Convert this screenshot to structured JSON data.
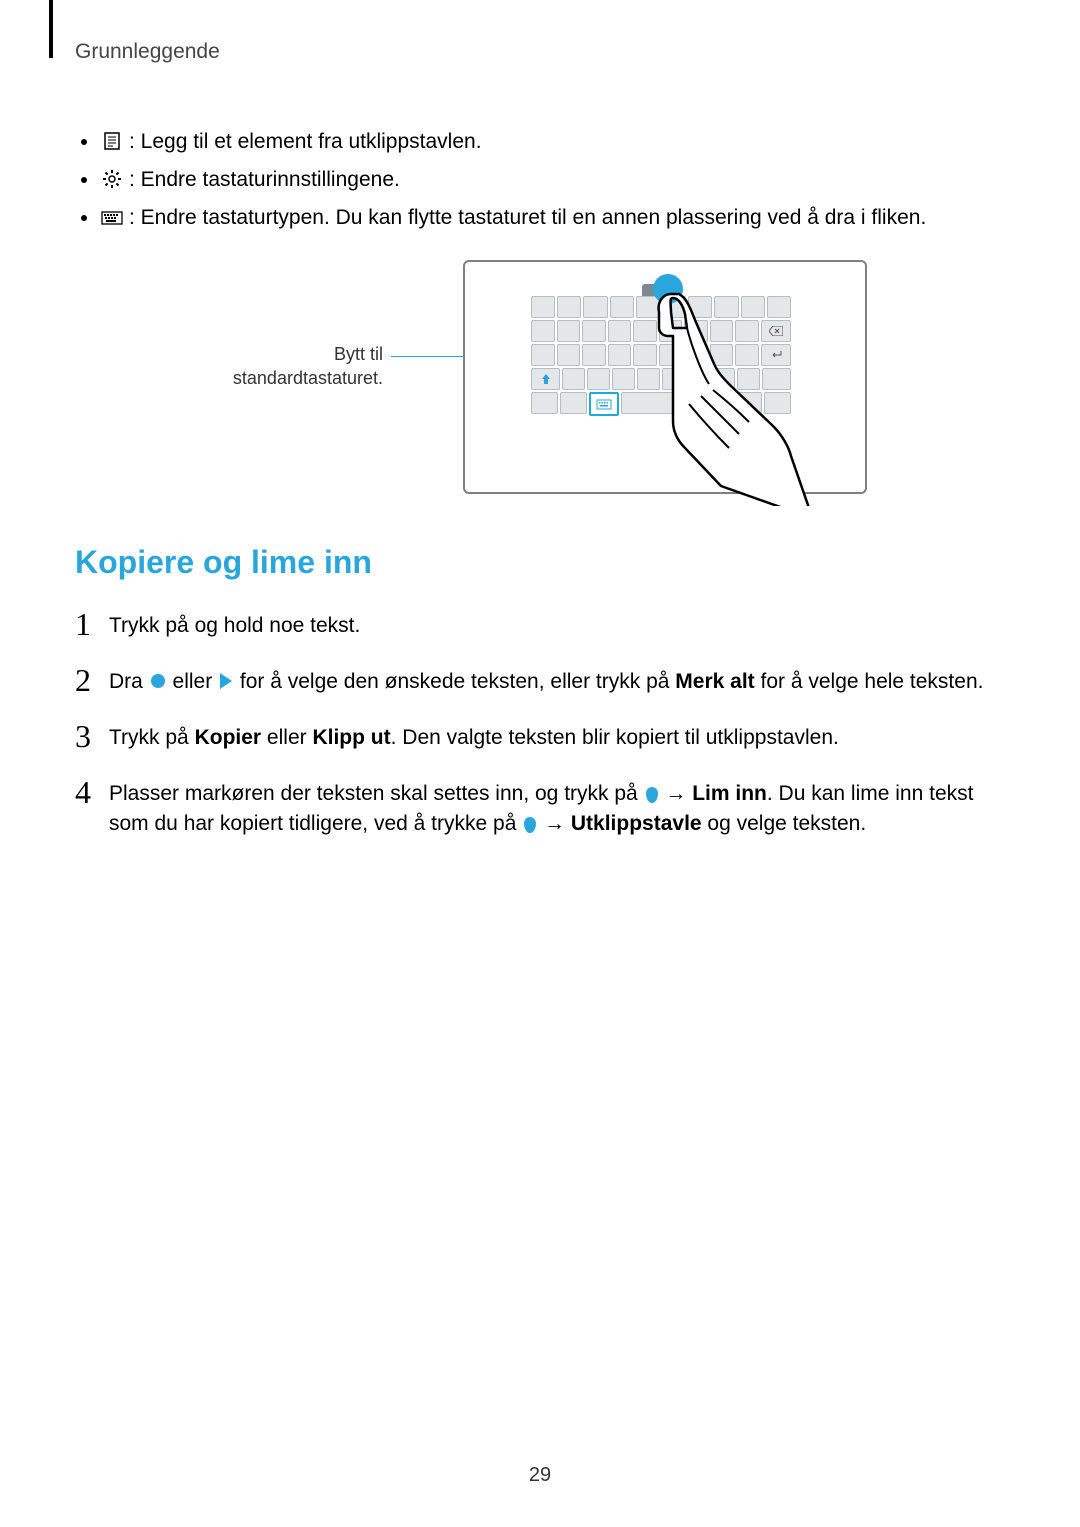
{
  "header": {
    "section": "Grunnleggende"
  },
  "bullets": {
    "b1": ": Legg til et element fra utklippstavlen.",
    "b2": ": Endre tastaturinnstillingene.",
    "b3": ": Endre tastaturtypen. Du kan flytte tastaturet til en annen plassering ved å dra i fliken."
  },
  "figure": {
    "caption_l1": "Bytt til",
    "caption_l2": "standardtastaturet."
  },
  "section_title": "Kopiere og lime inn",
  "steps": {
    "s1": "Trykk på og hold noe tekst.",
    "s2_a": "Dra ",
    "s2_b": " eller ",
    "s2_c": " for å velge den ønskede teksten, eller trykk på ",
    "s2_bold1": "Merk alt",
    "s2_d": " for å velge hele teksten.",
    "s3_a": "Trykk på ",
    "s3_bold1": "Kopier",
    "s3_b": " eller ",
    "s3_bold2": "Klipp ut",
    "s3_c": ". Den valgte teksten blir kopiert til utklippstavlen.",
    "s4_a": "Plasser markøren der teksten skal settes inn, og trykk på ",
    "s4_arrow1": " → ",
    "s4_bold1": "Lim inn",
    "s4_b": ". Du kan lime inn tekst som du har kopiert tidligere, ved å trykke på ",
    "s4_arrow2": " → ",
    "s4_bold2": "Utklippstavle",
    "s4_c": " og velge teksten."
  },
  "nums": {
    "n1": "1",
    "n2": "2",
    "n3": "3",
    "n4": "4"
  },
  "page_number": "29"
}
